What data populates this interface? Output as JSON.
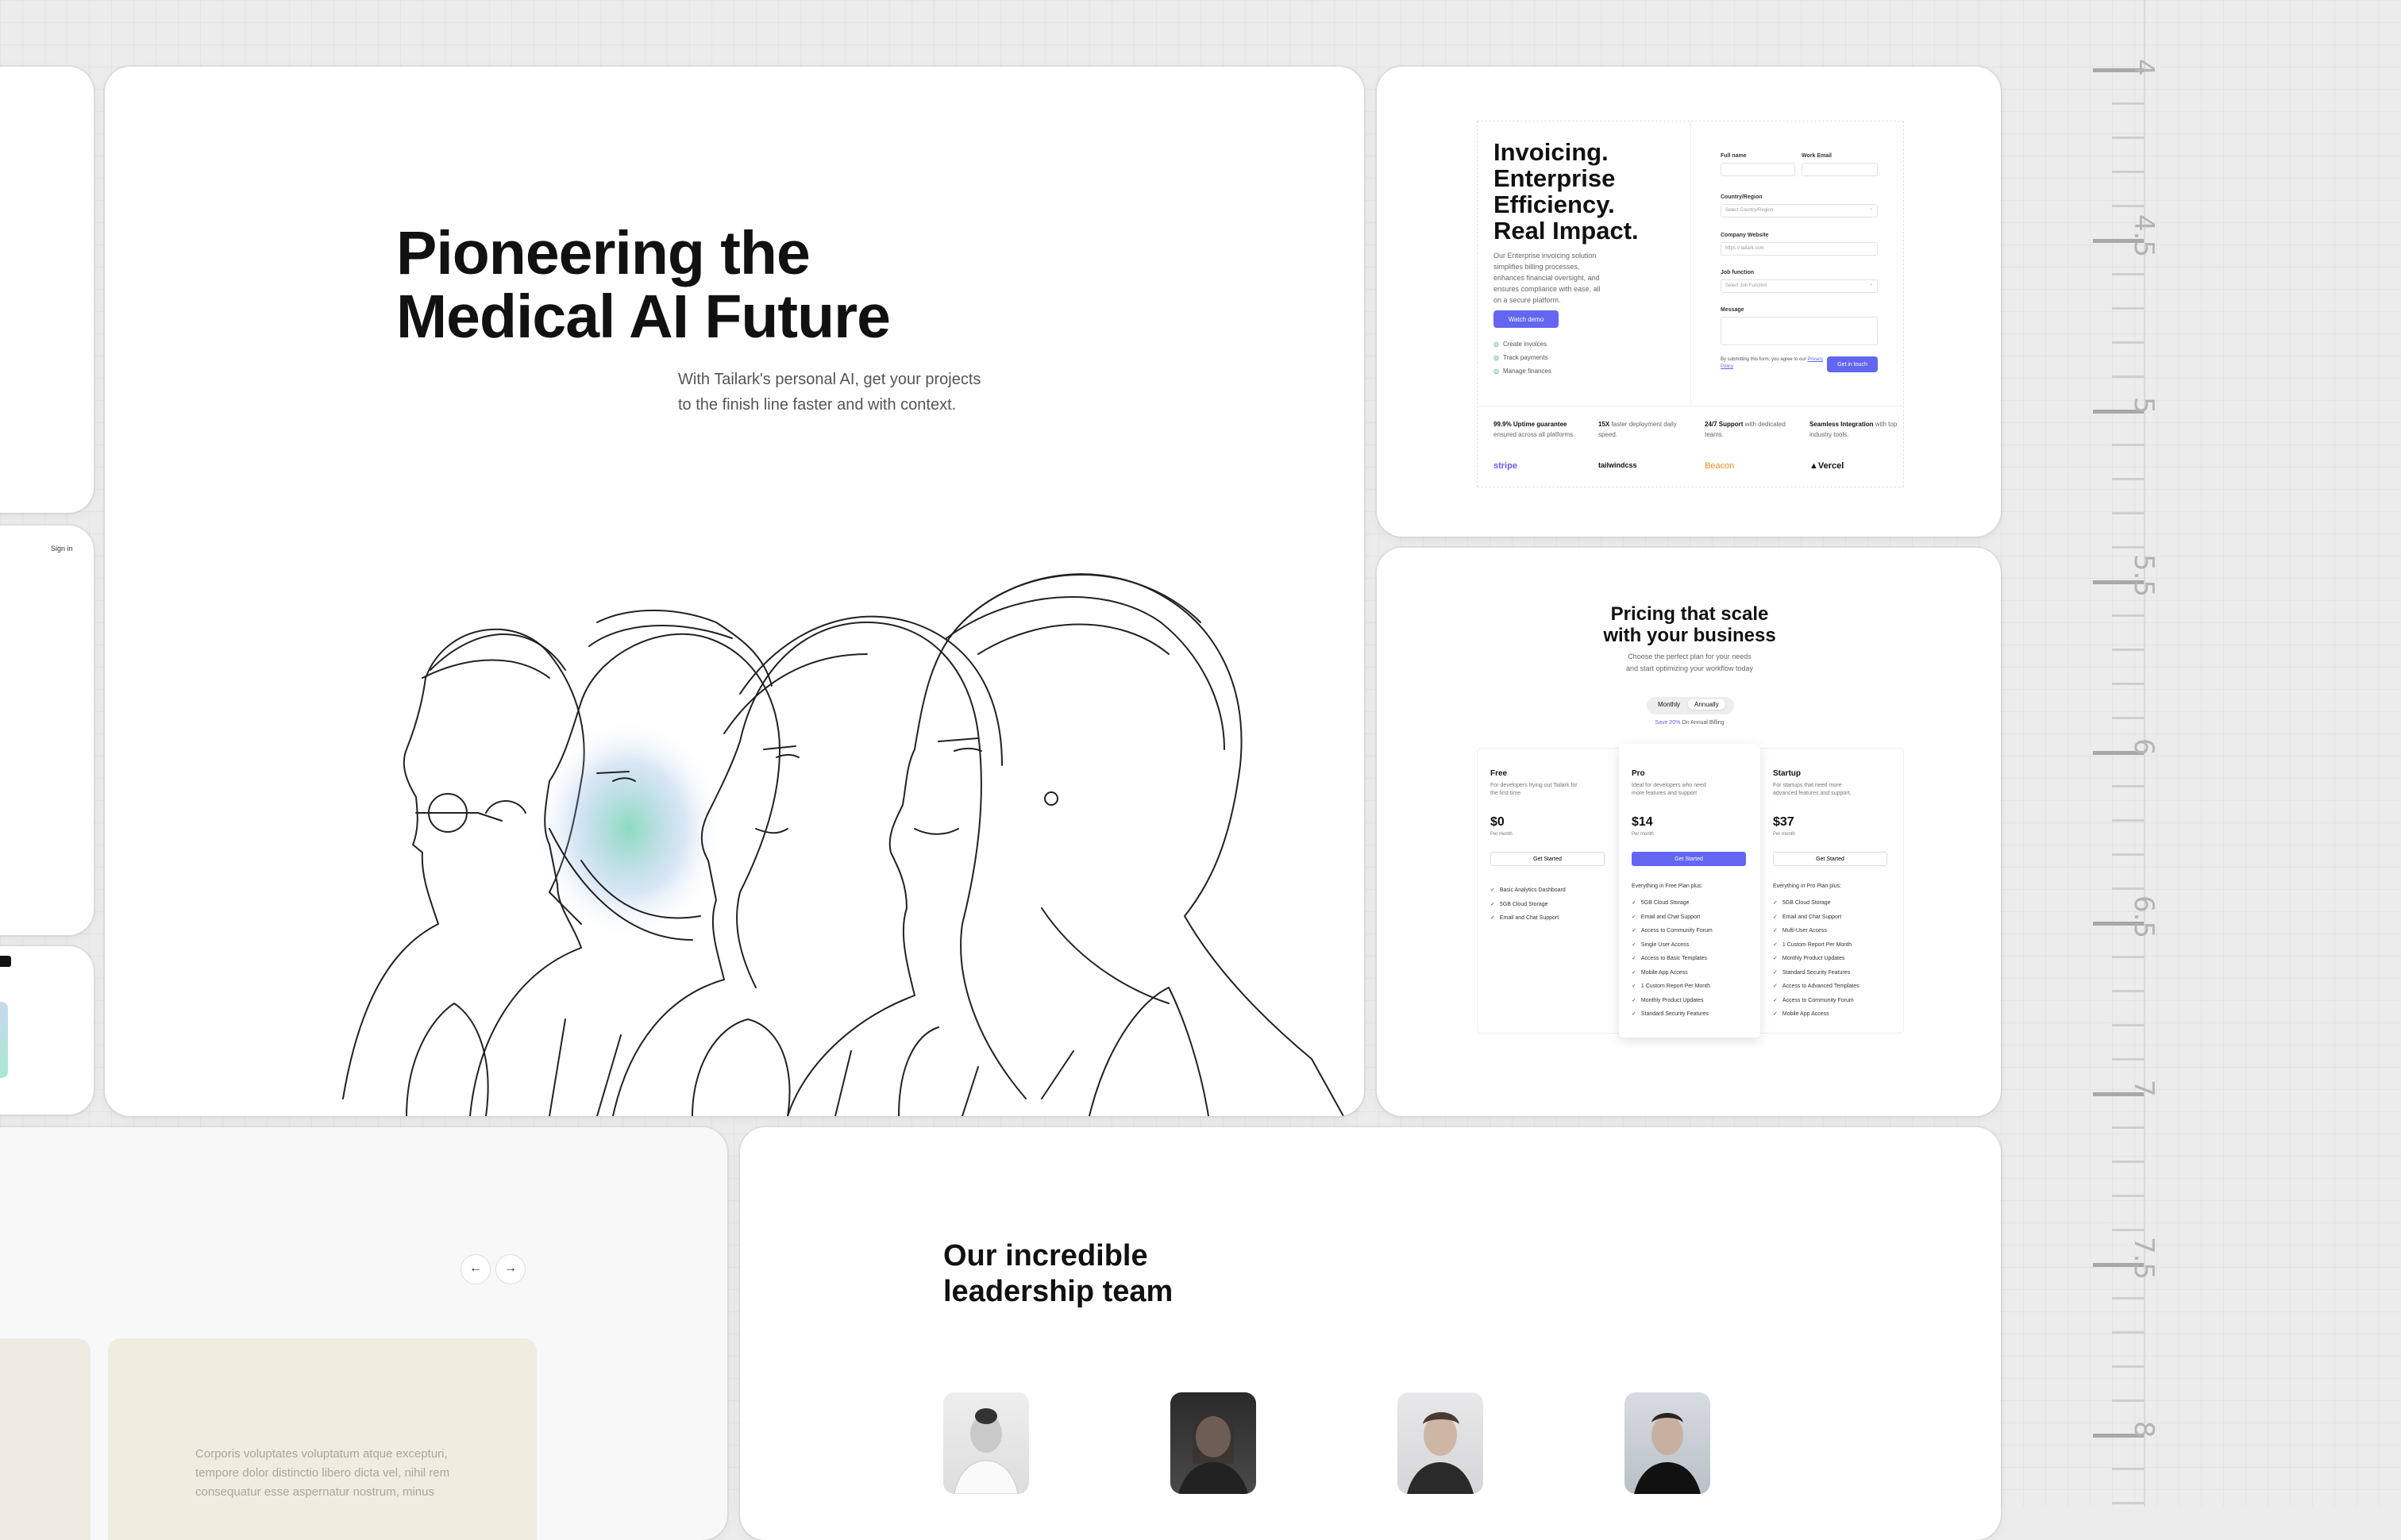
{
  "ruler": {
    "labels": [
      "4",
      "4.5",
      "5",
      "5.5",
      "6",
      "6.5",
      "7",
      "7.5",
      "8"
    ]
  },
  "hero": {
    "title_line1": "Pioneering the",
    "title_line2": "Medical AI Future",
    "subtitle_line1": "With Tailark's personal AI, get your projects",
    "subtitle_line2": "to the finish line faster and with context."
  },
  "left_card": {
    "signin": "Sign in"
  },
  "invoicing": {
    "title_line1": "Invoicing.",
    "title_line2": "Enterprise",
    "title_line3": "Efficiency.",
    "title_line4": "Real Impact.",
    "description": "Our Enterprise invoicing solution simplifies billing processes, enhances financial oversight, and ensures compliance with ease, all on a secure platform.",
    "cta": "Watch demo",
    "checks": [
      "Create invoices",
      "Track payments",
      "Manage finances"
    ],
    "form": {
      "full_name_label": "Full name",
      "work_email_label": "Work Email",
      "country_label": "Country/Region",
      "country_value": "Select Country/Region",
      "website_label": "Company Website",
      "website_placeholder": "https://  tailark.com",
      "job_label": "Job function",
      "job_value": "Select Job Function",
      "message_label": "Message",
      "consent_text": "By submitting this form, you agree to our",
      "privacy_link": "Privacy Policy",
      "submit": "Get in touch"
    },
    "stats": [
      {
        "bold": "99.9% Uptime guarantee",
        "rest": " ensured across all platforms."
      },
      {
        "bold": "15X",
        "rest": " faster deployment daily speed."
      },
      {
        "bold": "24/7 Support",
        "rest": " with dedicated teams."
      },
      {
        "bold": "Seamless Integration",
        "rest": " with top industry tools."
      }
    ],
    "logos": [
      "stripe",
      "tailwindcss",
      "Beacon",
      "▲Vercel"
    ]
  },
  "pricing": {
    "title_line1": "Pricing that scale",
    "title_line2": "with your business",
    "subtitle_line1": "Choose the perfect plan for your needs",
    "subtitle_line2": "and start optimizing your workflow today",
    "toggle_monthly": "Monthly",
    "toggle_annually": "Annually",
    "save_pct": "Save 20%",
    "save_rest": " On Annual Billing",
    "plans": [
      {
        "name": "Free",
        "desc": "For developers trying out Tailark for the first time",
        "price": "$0",
        "per": "Per month",
        "button": "Get Started",
        "heading": "",
        "features": [
          "Basic Analytics Dashboard",
          "5GB Cloud Storage",
          "Email and Chat Support"
        ]
      },
      {
        "name": "Pro",
        "desc": "Ideal for developers who need more features and support",
        "price": "$14",
        "per": "Per month",
        "button": "Get Started",
        "heading": "Everything in Free Plan plus:",
        "features": [
          "5GB Cloud Storage",
          "Email and Chat Support",
          "Access to Community Forum",
          "Single User Access",
          "Access to Basic Templates",
          "Mobile App Access",
          "1 Custom Report Per Month",
          "Monthly Product Updates",
          "Standard Security Features"
        ]
      },
      {
        "name": "Startup",
        "desc": "For startups that need more advanced features and support.",
        "price": "$37",
        "per": "Per month",
        "button": "Get Started",
        "heading": "Everything in Pro Plan plus:",
        "features": [
          "5GB Cloud Storage",
          "Email and Chat Support",
          "Multi-User Access",
          "1 Custom Report Per Month",
          "Monthly Product Updates",
          "Standard Security Features",
          "Access to Advanced Templates",
          "Access to Community Forum",
          "Mobile App Access"
        ]
      }
    ]
  },
  "team": {
    "title_line1": "Our incredible",
    "title_line2": "leadership team"
  },
  "carousel": {
    "prev_icon": "arrow-left-icon",
    "next_icon": "arrow-right-icon",
    "quote": "Corporis voluptates voluptatum atque excepturi, tempore dolor distinctio libero dicta vel, nihil rem consequatur esse aspernatur nostrum, minus"
  }
}
